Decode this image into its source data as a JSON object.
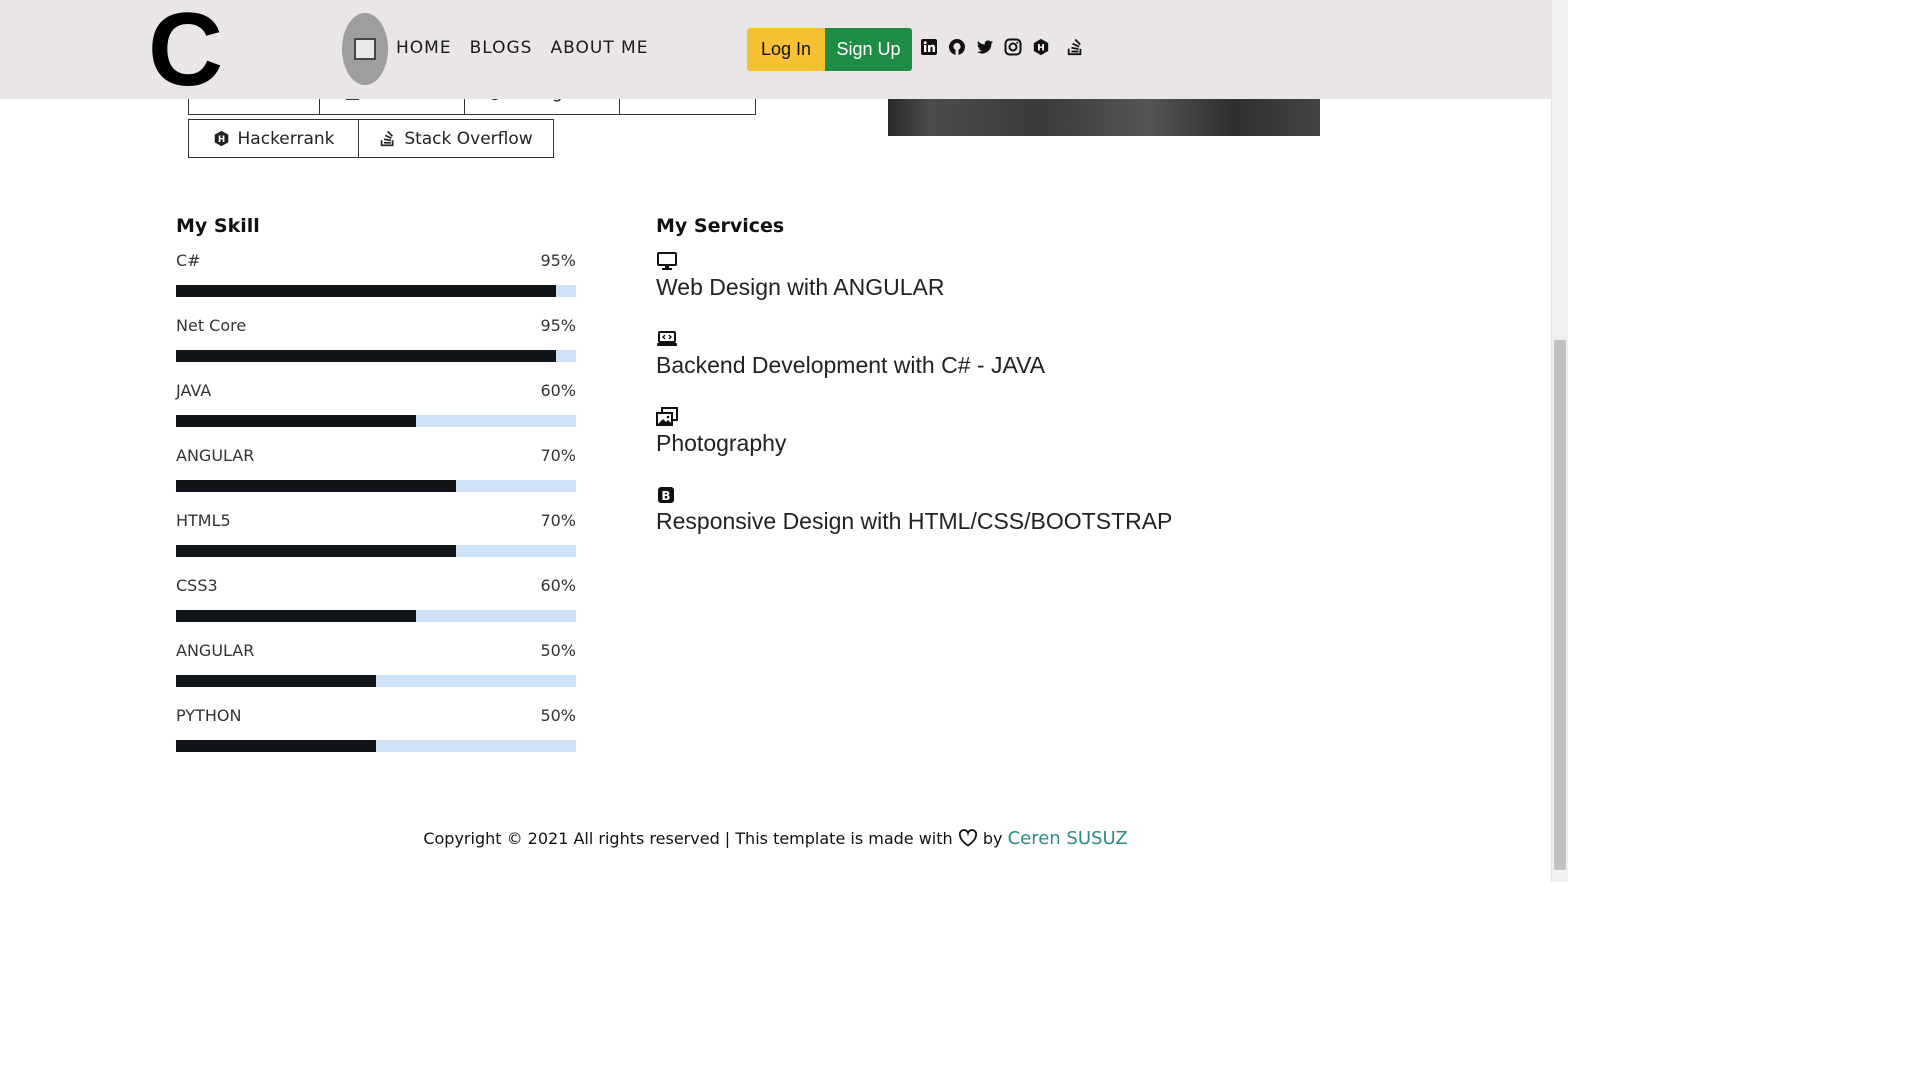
{
  "header": {
    "logo_text": "C",
    "nav": [
      "HOME",
      "BLOGS",
      "ABOUT ME"
    ],
    "login_label": "Log In",
    "signup_label": "Sign Up",
    "social_icons": [
      "linkedin-icon",
      "github-icon",
      "twitter-icon",
      "instagram-icon",
      "hackerrank-icon",
      "stackoverflow-icon"
    ],
    "colors": {
      "login_bg": "#f6c233",
      "signup_bg": "#1e8c45",
      "nav_bg": "#ebe6e6"
    }
  },
  "profile_links": {
    "row1": [
      "Github",
      "LinkedIn",
      "Instagram",
      "Twitter"
    ],
    "row2": [
      "Hackerrank",
      "Stack Overflow"
    ]
  },
  "skills": {
    "title": "My Skill",
    "items": [
      {
        "name": "C#",
        "percent_label": "95%",
        "value": 95
      },
      {
        "name": "Net Core",
        "percent_label": "95%",
        "value": 95
      },
      {
        "name": "JAVA",
        "percent_label": "60%",
        "value": 60
      },
      {
        "name": "ANGULAR",
        "percent_label": "70%",
        "value": 70
      },
      {
        "name": "HTML5",
        "percent_label": "70%",
        "value": 70
      },
      {
        "name": "CSS3",
        "percent_label": "60%",
        "value": 60
      },
      {
        "name": "ANGULAR",
        "percent_label": "50%",
        "value": 50
      },
      {
        "name": "PYTHON",
        "percent_label": "50%",
        "value": 50
      }
    ],
    "colors": {
      "fill": "#111418",
      "track": "#cfe2f8"
    }
  },
  "services": {
    "title": "My Services",
    "items": [
      {
        "label": "Web Design with ANGULAR",
        "icon": "monitor-icon"
      },
      {
        "label": "Backend Development with C# - JAVA",
        "icon": "laptop-code-icon"
      },
      {
        "label": "Photography",
        "icon": "images-icon"
      },
      {
        "label": "Responsive Design with HTML/CSS/BOOTSTRAP",
        "icon": "bootstrap-icon"
      }
    ]
  },
  "footer": {
    "text": "Copyright © 2021 All rights reserved | This template is made with",
    "by": "by",
    "author": "Ceren SUSUZ",
    "author_color": "#2c8a87"
  }
}
